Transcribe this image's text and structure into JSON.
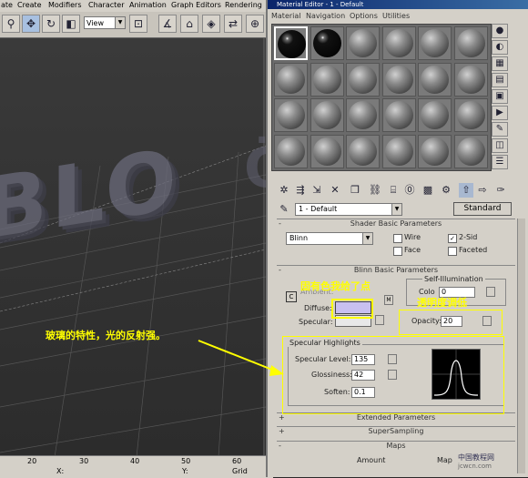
{
  "app_menu": [
    "ate",
    "Create",
    "Modifiers",
    "Character",
    "Animation",
    "Graph Editors",
    "Rendering"
  ],
  "toolbar": {
    "view_select": "View"
  },
  "viewport": {
    "text_3d": "BLO",
    "text_3d_faint": "Ö"
  },
  "timeline": {
    "ticks": [
      "20",
      "30",
      "40",
      "50",
      "60"
    ],
    "x_label": "X:",
    "y_label": "Y:",
    "grid_label": "Grid"
  },
  "material_editor": {
    "title": "Material Editor - 1 - Default",
    "menu": [
      "Material",
      "Navigation",
      "Options",
      "Utilities"
    ],
    "slot_rows": 4,
    "slot_cols": 6,
    "material_name": "1 - Default",
    "type_button": "Standard",
    "shader_rollout": {
      "title": "Shader Basic Parameters",
      "shader": "Blinn",
      "wire": "Wire",
      "two_sided": "2-Sid",
      "face_map": "Face",
      "faceted": "Faceted",
      "two_sided_checked": true
    },
    "blinn_rollout": {
      "title": "Blinn Basic Parameters",
      "self_illum_title": "Self-Illumination",
      "color_label": "Colo",
      "color_value": "0",
      "ambient": "Ambient:",
      "diffuse": "Diffuse:",
      "specular": "Specular:",
      "diffuse_color": "#c8c0f0",
      "opacity_label": "Opacity:",
      "opacity_value": "20",
      "specular_highlights_title": "Specular Highlights",
      "specular_level_label": "Specular Level:",
      "specular_level": "135",
      "glossiness_label": "Glossiness:",
      "glossiness": "42",
      "soften_label": "Soften:",
      "soften": "0.1",
      "letter_c": "C",
      "letter_m": "M"
    },
    "other_rollouts": [
      {
        "sign": "+",
        "title": "Extended Parameters"
      },
      {
        "sign": "+",
        "title": "SuperSampling"
      },
      {
        "sign": "-",
        "title": "Maps"
      }
    ],
    "maps_columns": [
      "Amount",
      "Map"
    ]
  },
  "annotations": {
    "diffuse_note": "固有色我给了点",
    "opacity_note": "透明度调低",
    "glass_note": "玻璃的特性，光的反射强。"
  },
  "watermark": {
    "line1": "中国教程网",
    "line2": "jcwcn.com"
  },
  "colors": {
    "annotation": "#ffff00",
    "titlebar": "#0a246a",
    "panel": "#d4d0c8"
  }
}
